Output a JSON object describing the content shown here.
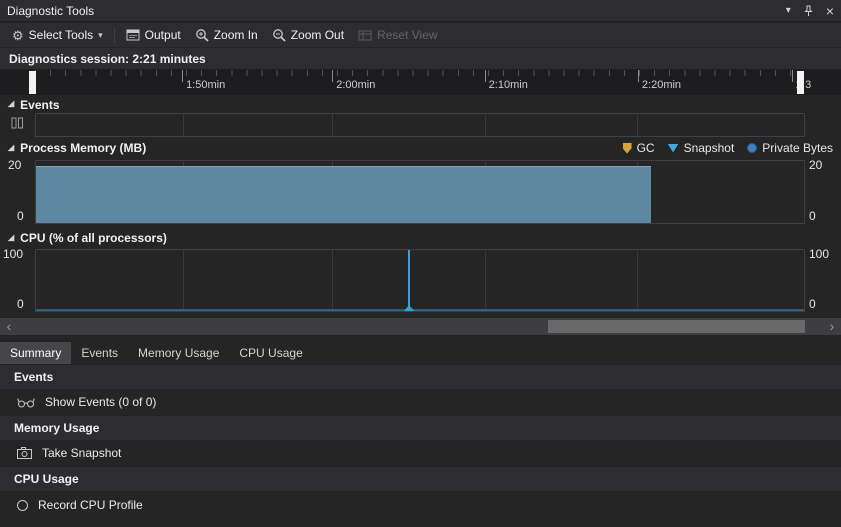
{
  "window": {
    "title": "Diagnostic Tools",
    "menu_chevron": "▾",
    "close_glyph": "×"
  },
  "toolbar": {
    "gear_glyph": "⚙",
    "select_tools_label": "Select Tools",
    "dropdown_chevron": "▾",
    "output_label": "Output",
    "zoom_in_label": "Zoom In",
    "zoom_out_label": "Zoom Out",
    "reset_view_label": "Reset View"
  },
  "session_bar": {
    "text": "Diagnostics session: 2:21 minutes"
  },
  "timeline": {
    "ticks": [
      {
        "label": "1:50min"
      },
      {
        "label": "2:00min"
      },
      {
        "label": "2:10min"
      },
      {
        "label": "2:20min"
      },
      {
        "label": "2:3"
      }
    ]
  },
  "events_section": {
    "collapse_glyph": "◢",
    "label": "Events"
  },
  "memory_section": {
    "collapse_glyph": "◢",
    "label": "Process Memory (MB)",
    "y_top": "20",
    "y_bottom": "0",
    "legend_gc": "GC",
    "legend_snapshot": "Snapshot",
    "legend_private_bytes": "Private Bytes"
  },
  "cpu_section": {
    "collapse_glyph": "◢",
    "label": "CPU (% of all processors)",
    "y_top": "100",
    "y_bottom": "0"
  },
  "scrollbar": {
    "left_arrow": "‹",
    "right_arrow": "›"
  },
  "tabs": [
    {
      "label": "Summary",
      "active": true
    },
    {
      "label": "Events",
      "active": false
    },
    {
      "label": "Memory Usage",
      "active": false
    },
    {
      "label": "CPU Usage",
      "active": false
    }
  ],
  "summary": {
    "events_header": "Events",
    "show_events_label": "Show Events (0 of 0)",
    "memory_header": "Memory Usage",
    "take_snapshot_label": "Take Snapshot",
    "cpu_header": "CPU Usage",
    "record_cpu_label": "Record CPU Profile"
  },
  "colors": {
    "memory_fill": "#5e87a1",
    "cpu_spike": "#3aa0dc",
    "gc_marker": "#dba23a",
    "snapshot_marker": "#45a8dc",
    "private_bytes_marker": "#3e7fc0",
    "panel_bg": "#252526",
    "chrome_bg": "#2d2d30"
  },
  "chart_data": [
    {
      "type": "area",
      "title": "Process Memory (MB)",
      "ylabel": "MB",
      "ylim": [
        0,
        20
      ],
      "x_ticks": [
        "1:50min",
        "2:00min",
        "2:10min",
        "2:20min",
        "2:3"
      ],
      "grid": "vertical-only",
      "legend": [
        "GC",
        "Snapshot",
        "Private Bytes"
      ],
      "legend_position": "top-right",
      "series": [
        {
          "name": "Private Bytes",
          "description": "steady ~19 MB from left edge, drops to 0 at ~80% of visible range (≈2:21)",
          "points_fraction_value": [
            [
              0,
              19
            ],
            [
              0.8,
              19
            ],
            [
              0.801,
              0
            ],
            [
              1,
              0
            ]
          ]
        }
      ]
    },
    {
      "type": "line",
      "title": "CPU (% of all processors)",
      "ylim": [
        0,
        100
      ],
      "grid": "vertical-only",
      "series": [
        {
          "name": "CPU",
          "description": "flat at 0% with a single spike to ~100% at ≈48% of visible range",
          "points_fraction_value": [
            [
              0,
              0
            ],
            [
              0.483,
              0
            ],
            [
              0.484,
              100
            ],
            [
              0.485,
              0
            ],
            [
              1,
              0
            ]
          ]
        }
      ]
    }
  ]
}
